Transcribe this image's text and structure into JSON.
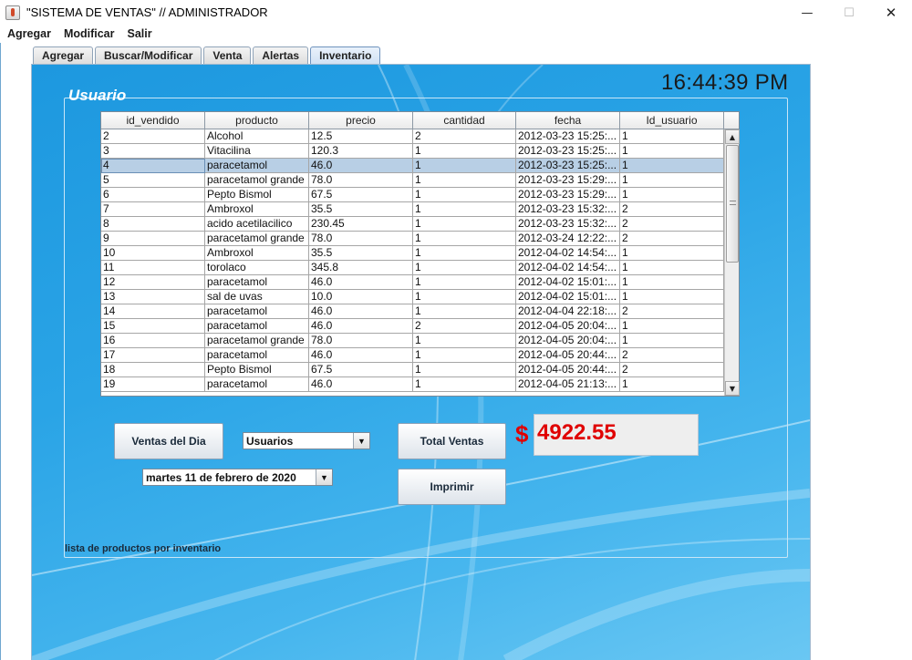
{
  "window": {
    "title": "\"SISTEMA DE VENTAS\" // ADMINISTRADOR",
    "minimize_glyph": "—",
    "maximize_glyph": "☐",
    "close_glyph": "✕"
  },
  "menu": [
    "Agregar",
    "Modificar",
    "Salir"
  ],
  "tabs": [
    {
      "label": "Agregar",
      "active": false
    },
    {
      "label": "Buscar/Modificar",
      "active": false
    },
    {
      "label": "Venta",
      "active": false
    },
    {
      "label": "Alertas",
      "active": false
    },
    {
      "label": "Inventario",
      "active": true
    }
  ],
  "clock": "16:44:39 PM",
  "group_title": "Usuario",
  "table": {
    "columns": [
      "id_vendido",
      "producto",
      "precio",
      "cantidad",
      "fecha",
      "Id_usuario"
    ],
    "selected_row": 2,
    "rows": [
      [
        "2",
        "Alcohol",
        "12.5",
        "2",
        "2012-03-23 15:25:...",
        "1"
      ],
      [
        "3",
        "Vitacilina",
        "120.3",
        "1",
        "2012-03-23 15:25:...",
        "1"
      ],
      [
        "4",
        "paracetamol",
        "46.0",
        "1",
        "2012-03-23 15:25:...",
        "1"
      ],
      [
        "5",
        "paracetamol grande",
        "78.0",
        "1",
        "2012-03-23 15:29:...",
        "1"
      ],
      [
        "6",
        "Pepto Bismol",
        "67.5",
        "1",
        "2012-03-23 15:29:...",
        "1"
      ],
      [
        "7",
        "Ambroxol",
        "35.5",
        "1",
        "2012-03-23 15:32:...",
        "2"
      ],
      [
        "8",
        "acido acetilacilico",
        "230.45",
        "1",
        "2012-03-23 15:32:...",
        "2"
      ],
      [
        "9",
        "paracetamol grande",
        "78.0",
        "1",
        "2012-03-24 12:22:...",
        "2"
      ],
      [
        "10",
        "Ambroxol",
        "35.5",
        "1",
        "2012-04-02 14:54:...",
        "1"
      ],
      [
        "11",
        "torolaco",
        "345.8",
        "1",
        "2012-04-02 14:54:...",
        "1"
      ],
      [
        "12",
        "paracetamol",
        "46.0",
        "1",
        "2012-04-02 15:01:...",
        "1"
      ],
      [
        "13",
        "sal de uvas",
        "10.0",
        "1",
        "2012-04-02 15:01:...",
        "1"
      ],
      [
        "14",
        "paracetamol",
        "46.0",
        "1",
        "2012-04-04 22:18:...",
        "2"
      ],
      [
        "15",
        "paracetamol",
        "46.0",
        "2",
        "2012-04-05 20:04:...",
        "1"
      ],
      [
        "16",
        "paracetamol grande",
        "78.0",
        "1",
        "2012-04-05 20:04:...",
        "1"
      ],
      [
        "17",
        "paracetamol",
        "46.0",
        "1",
        "2012-04-05 20:44:...",
        "2"
      ],
      [
        "18",
        "Pepto Bismol",
        "67.5",
        "1",
        "2012-04-05 20:44:...",
        "2"
      ],
      [
        "19",
        "paracetamol",
        "46.0",
        "1",
        "2012-04-05 21:13:...",
        "1"
      ]
    ]
  },
  "buttons": {
    "ventas_del_dia": "Ventas del Dia",
    "total_ventas": "Total Ventas",
    "imprimir": "Imprimir"
  },
  "combos": {
    "usuarios": "Usuarios",
    "fecha": "martes 11 de febrero de 2020"
  },
  "total": {
    "currency_symbol": "$",
    "value": "4922.55",
    "color": "#e00000"
  },
  "footer_label": "lista de productos por inventario",
  "colors": {
    "panel_blue": "#2aa4e6",
    "selection": "#b8cfe5"
  }
}
